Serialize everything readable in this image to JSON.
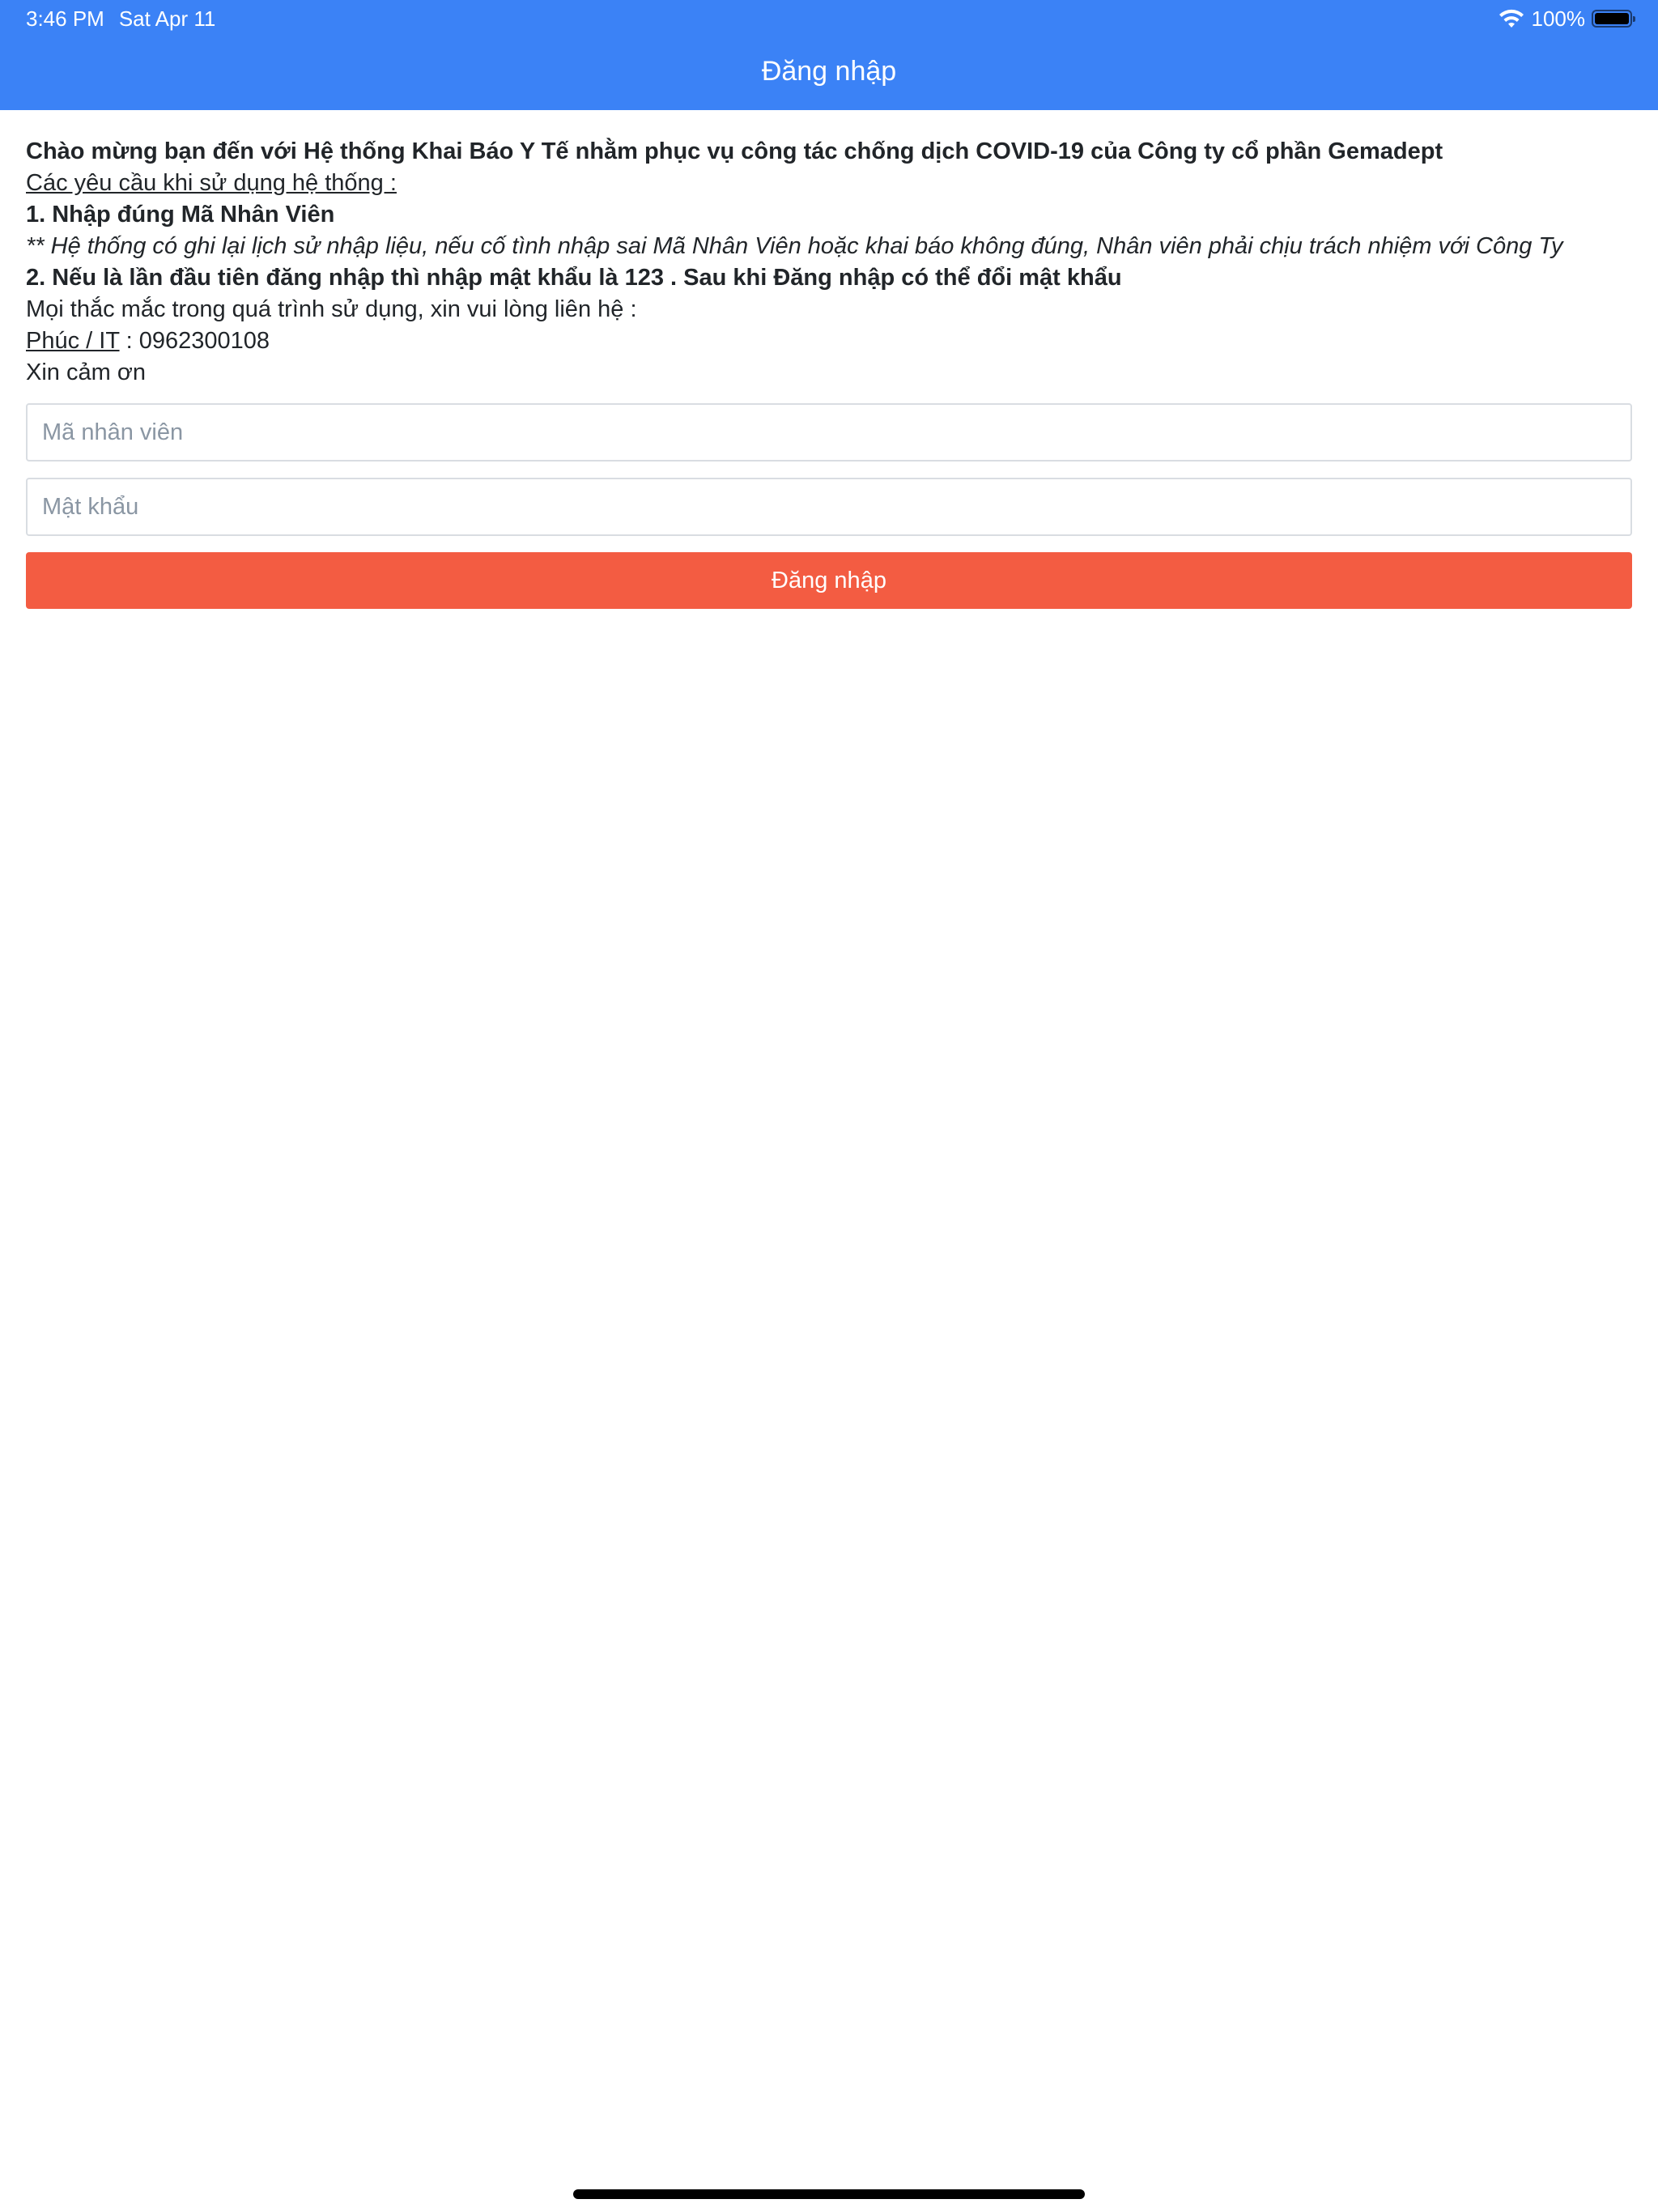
{
  "status_bar": {
    "time": "3:46 PM",
    "date": "Sat Apr 11",
    "battery": "100%",
    "battery_level": 1.0
  },
  "header": {
    "title": "Đăng nhập"
  },
  "intro": {
    "welcome": "Chào mừng bạn đến với Hệ thống Khai Báo Y Tế nhằm phục vụ công tác chống dịch COVID-19 của Công ty cổ phần Gemadept",
    "requirements_heading": "Các yêu cầu khi sử dụng hệ thống :",
    "req1": "1. Nhập đúng Mã Nhân Viên",
    "req1_note": "** Hệ thống có ghi lại lịch sử nhập liệu, nếu cố tình nhập sai Mã Nhân Viên hoặc khai báo không đúng, Nhân viên phải chịu trách nhiệm với Công Ty",
    "req2": "2. Nếu là lần đầu tiên đăng nhập thì nhập mật khẩu là 123 . Sau khi Đăng nhập có thể đổi mật khẩu",
    "contact_line": "Mọi thắc mắc trong quá trình sử dụng, xin vui lòng liên hệ :",
    "contact_name": "Phúc / IT",
    "contact_sep": " : ",
    "contact_phone": "0962300108",
    "thanks": "Xin cảm ơn"
  },
  "form": {
    "employee_id": {
      "value": "",
      "placeholder": "Mã nhân viên"
    },
    "password": {
      "value": "",
      "placeholder": "Mật khẩu"
    },
    "submit_label": "Đăng nhập"
  },
  "colors": {
    "header_bg": "#3b82f6",
    "button_bg": "#f35c42"
  }
}
